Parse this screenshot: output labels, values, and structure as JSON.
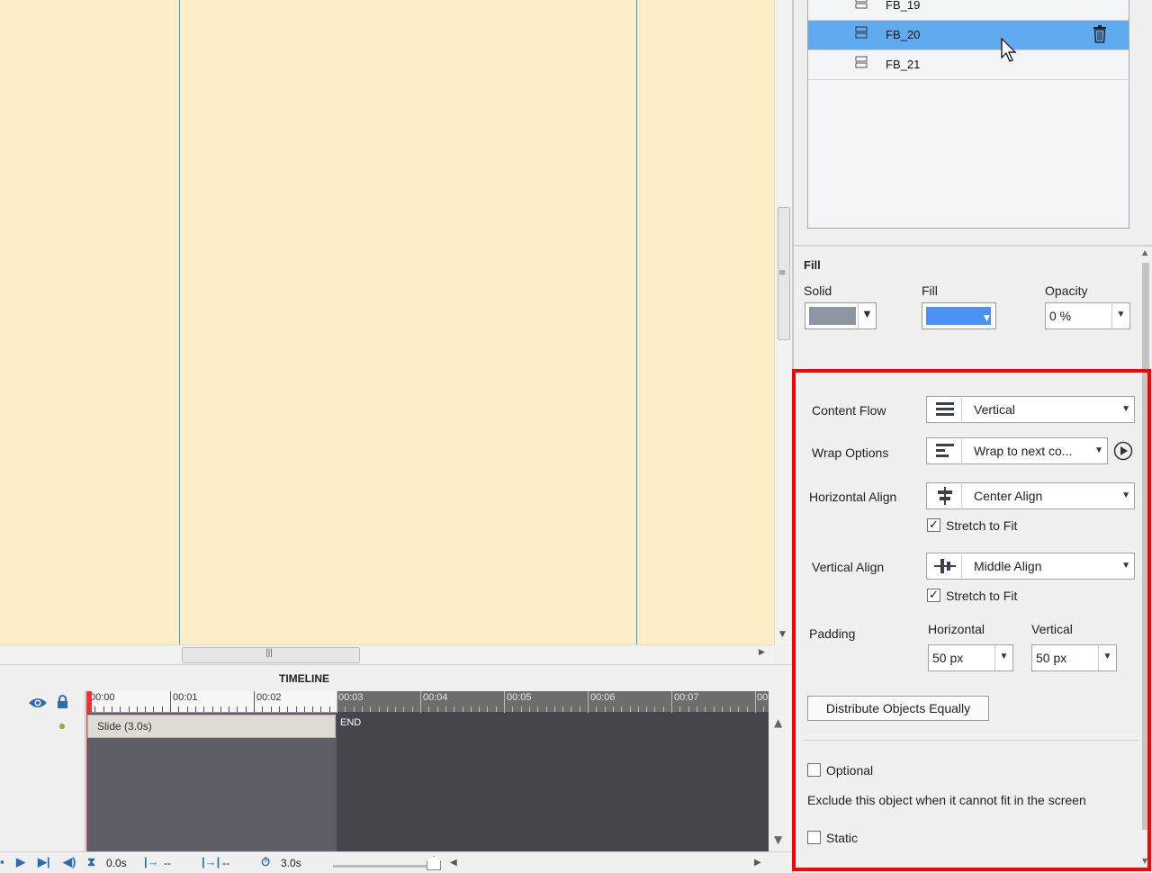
{
  "timeline": {
    "title": "TIMELINE",
    "ticks": [
      "00:00",
      "00:01",
      "00:02",
      "00:03",
      "00:04",
      "00:05",
      "00:06",
      "00:07",
      "00"
    ],
    "slide_label": "Slide (3.0s)",
    "end_label": "END",
    "footer": {
      "start_time": "0.0s",
      "in_time": "--",
      "out_time": "--",
      "duration": "3.0s"
    }
  },
  "layers": {
    "items": [
      {
        "name": "FB_19",
        "selected": false
      },
      {
        "name": "FB_20",
        "selected": true
      },
      {
        "name": "FB_21",
        "selected": false
      }
    ]
  },
  "fill": {
    "heading": "Fill",
    "solid_label": "Solid",
    "solid_color": "#8e94a2",
    "fill_label": "Fill",
    "fill_color": "#4b92f7",
    "opacity_label": "Opacity",
    "opacity_value": "0 %"
  },
  "layout": {
    "content_flow_label": "Content Flow",
    "content_flow_value": "Vertical",
    "wrap_options_label": "Wrap Options",
    "wrap_options_value": "Wrap to next co...",
    "horizontal_align_label": "Horizontal Align",
    "horizontal_align_value": "Center Align",
    "stretch_to_fit_h": "Stretch to Fit",
    "vertical_align_label": "Vertical Align",
    "vertical_align_value": "Middle Align",
    "stretch_to_fit_v": "Stretch to Fit",
    "padding_label": "Padding",
    "padding_horizontal_label": "Horizontal",
    "padding_horizontal_value": "50 px",
    "padding_vertical_label": "Vertical",
    "padding_vertical_value": "50 px",
    "distribute_button": "Distribute Objects Equally",
    "optional_label": "Optional",
    "optional_desc": "Exclude this object when it cannot fit in the screen",
    "static_label": "Static"
  },
  "colors": {
    "stage_bg": "#fdeec8",
    "selection": "#60aaf0",
    "highlight": "#ff0000"
  }
}
